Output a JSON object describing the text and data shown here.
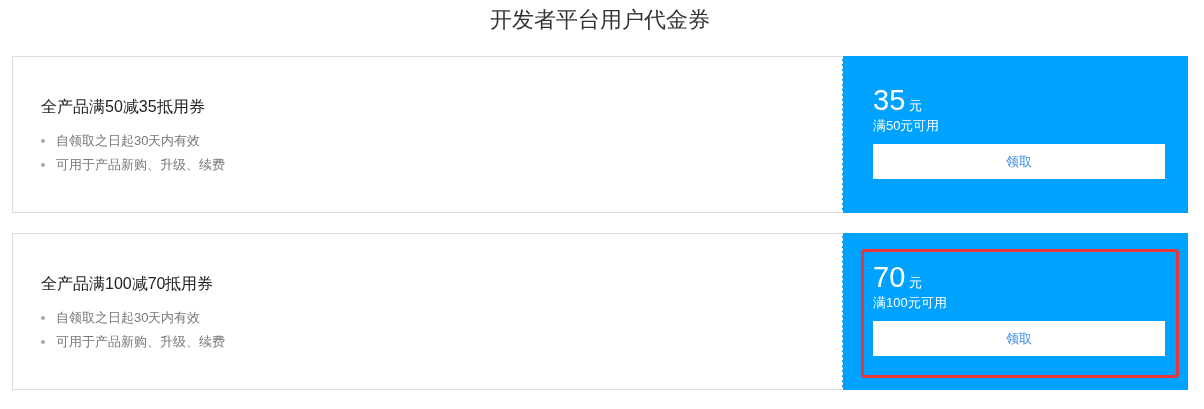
{
  "page_title": "开发者平台用户代金券",
  "coupons": [
    {
      "name": "全产品满50减35抵用券",
      "terms": [
        "自领取之日起30天内有效",
        "可用于产品新购、升级、续费"
      ],
      "amount": "35",
      "unit": "元",
      "condition": "满50元可用",
      "button": "领取",
      "highlighted": false
    },
    {
      "name": "全产品满100减70抵用券",
      "terms": [
        "自领取之日起30天内有效",
        "可用于产品新购、升级、续费"
      ],
      "amount": "70",
      "unit": "元",
      "condition": "满100元可用",
      "button": "领取",
      "highlighted": true
    }
  ]
}
